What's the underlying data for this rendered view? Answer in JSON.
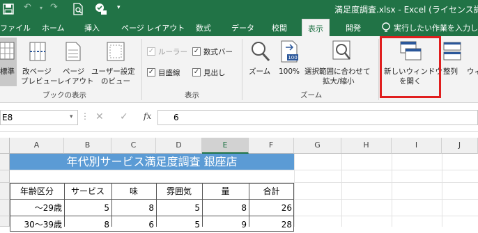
{
  "titlebar": {
    "save_icon": "save-icon",
    "file_title": "満足度調査.xlsx - Excel (ライセンス認証"
  },
  "tabs": [
    "ファイル",
    "ホーム",
    "挿入",
    "ページ レイアウト",
    "数式",
    "データ",
    "校閲",
    "表示",
    "開発"
  ],
  "active_tab": "表示",
  "tell_me": "実行したい作業を入力し",
  "ribbon": {
    "workbook_views": {
      "group_label": "ブックの表示",
      "normal": "標準",
      "page_break": [
        "改ページ",
        "プレビュー"
      ],
      "page_layout": [
        "ページ",
        "レイアウト"
      ],
      "custom": [
        "ユーザー設定",
        "のビュー"
      ]
    },
    "show": {
      "group_label": "表示",
      "ruler": "ルーラー",
      "formula_bar": "数式バー",
      "gridlines": "目盛線",
      "headings": "見出し"
    },
    "zoom": {
      "group_label": "ズーム",
      "zoom": "ズーム",
      "hundred": "100%",
      "zoom_to_selection": [
        "選択範囲に合わせて",
        "拡大/縮小"
      ],
      "icon_100": "100"
    },
    "window": {
      "new_window": [
        "新しいウィンドウ",
        "を開く"
      ],
      "arrange": "整列",
      "freeze_partial": "ウィ"
    }
  },
  "formula_bar": {
    "name_box": "E8",
    "value": "6",
    "fx": "fx"
  },
  "columns": [
    "A",
    "B",
    "C",
    "D",
    "E",
    "F",
    "G",
    "H",
    "I",
    "J"
  ],
  "selected_column": "E",
  "sheet": {
    "title": "年代別サービス満足度調査 銀座店",
    "headers": [
      "年齢区分",
      "サービス",
      "味",
      "雰囲気",
      "量",
      "合計"
    ],
    "rows": [
      [
        "～29歳",
        "5",
        "8",
        "5",
        "8",
        "26"
      ],
      [
        "30～39歳",
        "8",
        "6",
        "5",
        "9",
        "28"
      ]
    ]
  },
  "colors": {
    "excel_green": "#217346",
    "title_fill": "#5b9bd5",
    "highlight": "#e01e1e"
  }
}
